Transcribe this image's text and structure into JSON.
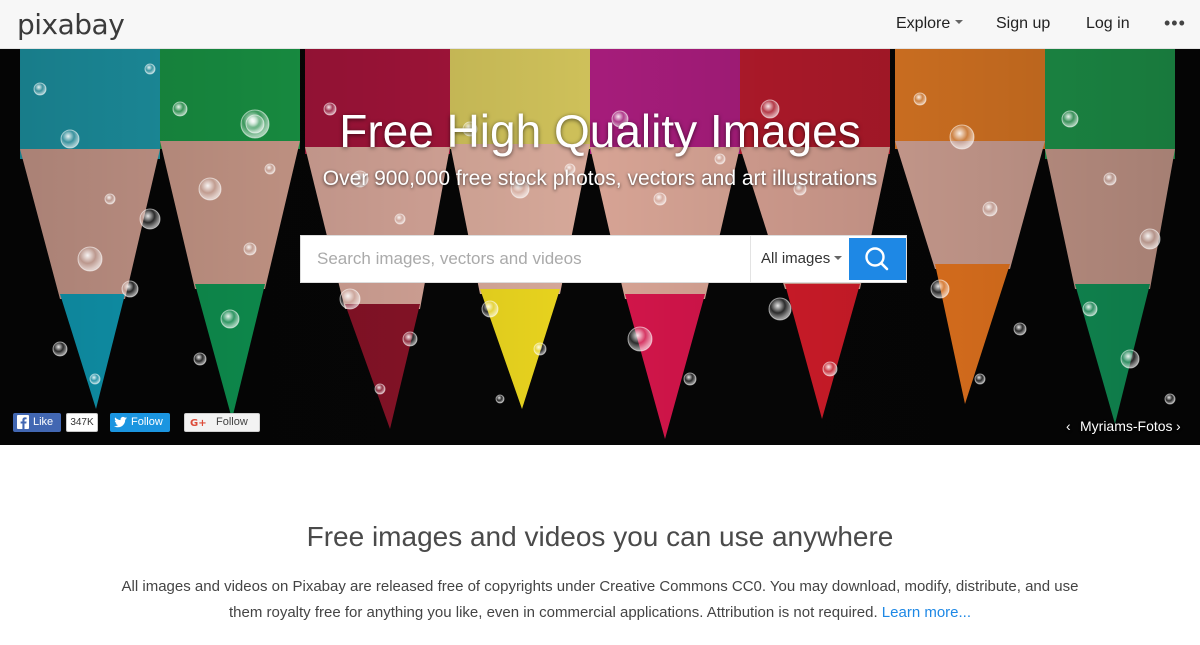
{
  "header": {
    "logo": "pixabay",
    "nav": {
      "explore": "Explore",
      "signup": "Sign up",
      "login": "Log in",
      "more": "•••"
    }
  },
  "hero": {
    "title": "Free High Quality Images",
    "subtitle": "Over 900,000 free stock photos, vectors and art illustrations",
    "search": {
      "placeholder": "Search images, vectors and videos",
      "value": "",
      "type": "All images"
    },
    "social": {
      "fb_like": "Like",
      "fb_count": "347K",
      "twitter_follow": "Follow",
      "gplus_follow": "Follow"
    },
    "credit": {
      "name": "Myriams-Fotos",
      "prev": "‹",
      "next": "›"
    }
  },
  "content": {
    "headline": "Free images and videos you can use anywhere",
    "description": "All images and videos on Pixabay are released free of copyrights under Creative Commons CC0. You may download, modify, distribute, and use them royalty free for anything you like, even in commercial applications. Attribution is not required.",
    "learn_more": "Learn more..."
  },
  "colors": {
    "accent": "#1e88e5",
    "facebook": "#4267b2",
    "twitter": "#1b95e0"
  }
}
